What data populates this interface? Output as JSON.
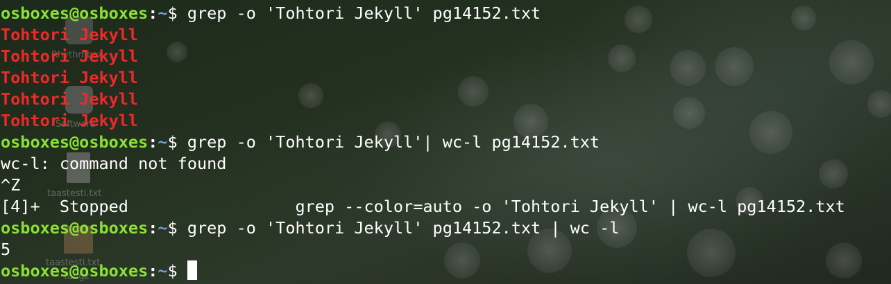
{
  "prompt": {
    "user_host": "osboxes@osboxes",
    "separator": ":",
    "path": "~",
    "symbol": "$"
  },
  "desktop_icons": [
    {
      "name": "rhythmbox-icon",
      "label": "Rhythmbox"
    },
    {
      "name": "software-icon",
      "label": "Software"
    },
    {
      "name": "text-file-icon",
      "label": "taastesti.txt"
    },
    {
      "name": "archive-file-icon",
      "label": "taastesti.txt.",
      "label2": "tar.gz"
    }
  ],
  "terminal": {
    "cmd1": " grep -o 'Tohtori Jekyll' pg14152.txt",
    "matches": [
      "Tohtori Jekyll",
      "Tohtori Jekyll",
      "Tohtori Jekyll",
      "Tohtori Jekyll",
      "Tohtori Jekyll"
    ],
    "cmd2": " grep -o 'Tohtori Jekyll'| wc-l pg14152.txt",
    "err": "wc-l: command not found",
    "ctrlz": "^Z",
    "stopped": "[4]+  Stopped                 grep --color=auto -o 'Tohtori Jekyll' | wc-l pg14152.txt",
    "cmd3": " grep -o 'Tohtori Jekyll' pg14152.txt | wc -l",
    "count": "5",
    "cmd4": " "
  },
  "colors": {
    "prompt_user": "#8ae234",
    "prompt_path": "#729fcf",
    "match": "#ef2929",
    "text": "#ffffff"
  }
}
